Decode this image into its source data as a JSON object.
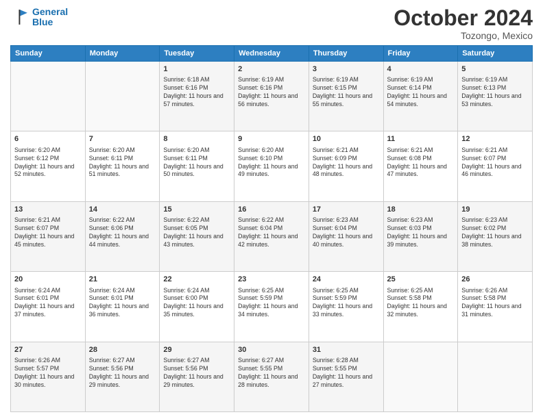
{
  "header": {
    "logo_line1": "General",
    "logo_line2": "Blue",
    "month_title": "October 2024",
    "location": "Tozongo, Mexico"
  },
  "days_of_week": [
    "Sunday",
    "Monday",
    "Tuesday",
    "Wednesday",
    "Thursday",
    "Friday",
    "Saturday"
  ],
  "weeks": [
    [
      {
        "day": "",
        "info": ""
      },
      {
        "day": "",
        "info": ""
      },
      {
        "day": "1",
        "info": "Sunrise: 6:18 AM\nSunset: 6:16 PM\nDaylight: 11 hours and 57 minutes."
      },
      {
        "day": "2",
        "info": "Sunrise: 6:19 AM\nSunset: 6:16 PM\nDaylight: 11 hours and 56 minutes."
      },
      {
        "day": "3",
        "info": "Sunrise: 6:19 AM\nSunset: 6:15 PM\nDaylight: 11 hours and 55 minutes."
      },
      {
        "day": "4",
        "info": "Sunrise: 6:19 AM\nSunset: 6:14 PM\nDaylight: 11 hours and 54 minutes."
      },
      {
        "day": "5",
        "info": "Sunrise: 6:19 AM\nSunset: 6:13 PM\nDaylight: 11 hours and 53 minutes."
      }
    ],
    [
      {
        "day": "6",
        "info": "Sunrise: 6:20 AM\nSunset: 6:12 PM\nDaylight: 11 hours and 52 minutes."
      },
      {
        "day": "7",
        "info": "Sunrise: 6:20 AM\nSunset: 6:11 PM\nDaylight: 11 hours and 51 minutes."
      },
      {
        "day": "8",
        "info": "Sunrise: 6:20 AM\nSunset: 6:11 PM\nDaylight: 11 hours and 50 minutes."
      },
      {
        "day": "9",
        "info": "Sunrise: 6:20 AM\nSunset: 6:10 PM\nDaylight: 11 hours and 49 minutes."
      },
      {
        "day": "10",
        "info": "Sunrise: 6:21 AM\nSunset: 6:09 PM\nDaylight: 11 hours and 48 minutes."
      },
      {
        "day": "11",
        "info": "Sunrise: 6:21 AM\nSunset: 6:08 PM\nDaylight: 11 hours and 47 minutes."
      },
      {
        "day": "12",
        "info": "Sunrise: 6:21 AM\nSunset: 6:07 PM\nDaylight: 11 hours and 46 minutes."
      }
    ],
    [
      {
        "day": "13",
        "info": "Sunrise: 6:21 AM\nSunset: 6:07 PM\nDaylight: 11 hours and 45 minutes."
      },
      {
        "day": "14",
        "info": "Sunrise: 6:22 AM\nSunset: 6:06 PM\nDaylight: 11 hours and 44 minutes."
      },
      {
        "day": "15",
        "info": "Sunrise: 6:22 AM\nSunset: 6:05 PM\nDaylight: 11 hours and 43 minutes."
      },
      {
        "day": "16",
        "info": "Sunrise: 6:22 AM\nSunset: 6:04 PM\nDaylight: 11 hours and 42 minutes."
      },
      {
        "day": "17",
        "info": "Sunrise: 6:23 AM\nSunset: 6:04 PM\nDaylight: 11 hours and 40 minutes."
      },
      {
        "day": "18",
        "info": "Sunrise: 6:23 AM\nSunset: 6:03 PM\nDaylight: 11 hours and 39 minutes."
      },
      {
        "day": "19",
        "info": "Sunrise: 6:23 AM\nSunset: 6:02 PM\nDaylight: 11 hours and 38 minutes."
      }
    ],
    [
      {
        "day": "20",
        "info": "Sunrise: 6:24 AM\nSunset: 6:01 PM\nDaylight: 11 hours and 37 minutes."
      },
      {
        "day": "21",
        "info": "Sunrise: 6:24 AM\nSunset: 6:01 PM\nDaylight: 11 hours and 36 minutes."
      },
      {
        "day": "22",
        "info": "Sunrise: 6:24 AM\nSunset: 6:00 PM\nDaylight: 11 hours and 35 minutes."
      },
      {
        "day": "23",
        "info": "Sunrise: 6:25 AM\nSunset: 5:59 PM\nDaylight: 11 hours and 34 minutes."
      },
      {
        "day": "24",
        "info": "Sunrise: 6:25 AM\nSunset: 5:59 PM\nDaylight: 11 hours and 33 minutes."
      },
      {
        "day": "25",
        "info": "Sunrise: 6:25 AM\nSunset: 5:58 PM\nDaylight: 11 hours and 32 minutes."
      },
      {
        "day": "26",
        "info": "Sunrise: 6:26 AM\nSunset: 5:58 PM\nDaylight: 11 hours and 31 minutes."
      }
    ],
    [
      {
        "day": "27",
        "info": "Sunrise: 6:26 AM\nSunset: 5:57 PM\nDaylight: 11 hours and 30 minutes."
      },
      {
        "day": "28",
        "info": "Sunrise: 6:27 AM\nSunset: 5:56 PM\nDaylight: 11 hours and 29 minutes."
      },
      {
        "day": "29",
        "info": "Sunrise: 6:27 AM\nSunset: 5:56 PM\nDaylight: 11 hours and 29 minutes."
      },
      {
        "day": "30",
        "info": "Sunrise: 6:27 AM\nSunset: 5:55 PM\nDaylight: 11 hours and 28 minutes."
      },
      {
        "day": "31",
        "info": "Sunrise: 6:28 AM\nSunset: 5:55 PM\nDaylight: 11 hours and 27 minutes."
      },
      {
        "day": "",
        "info": ""
      },
      {
        "day": "",
        "info": ""
      }
    ]
  ]
}
